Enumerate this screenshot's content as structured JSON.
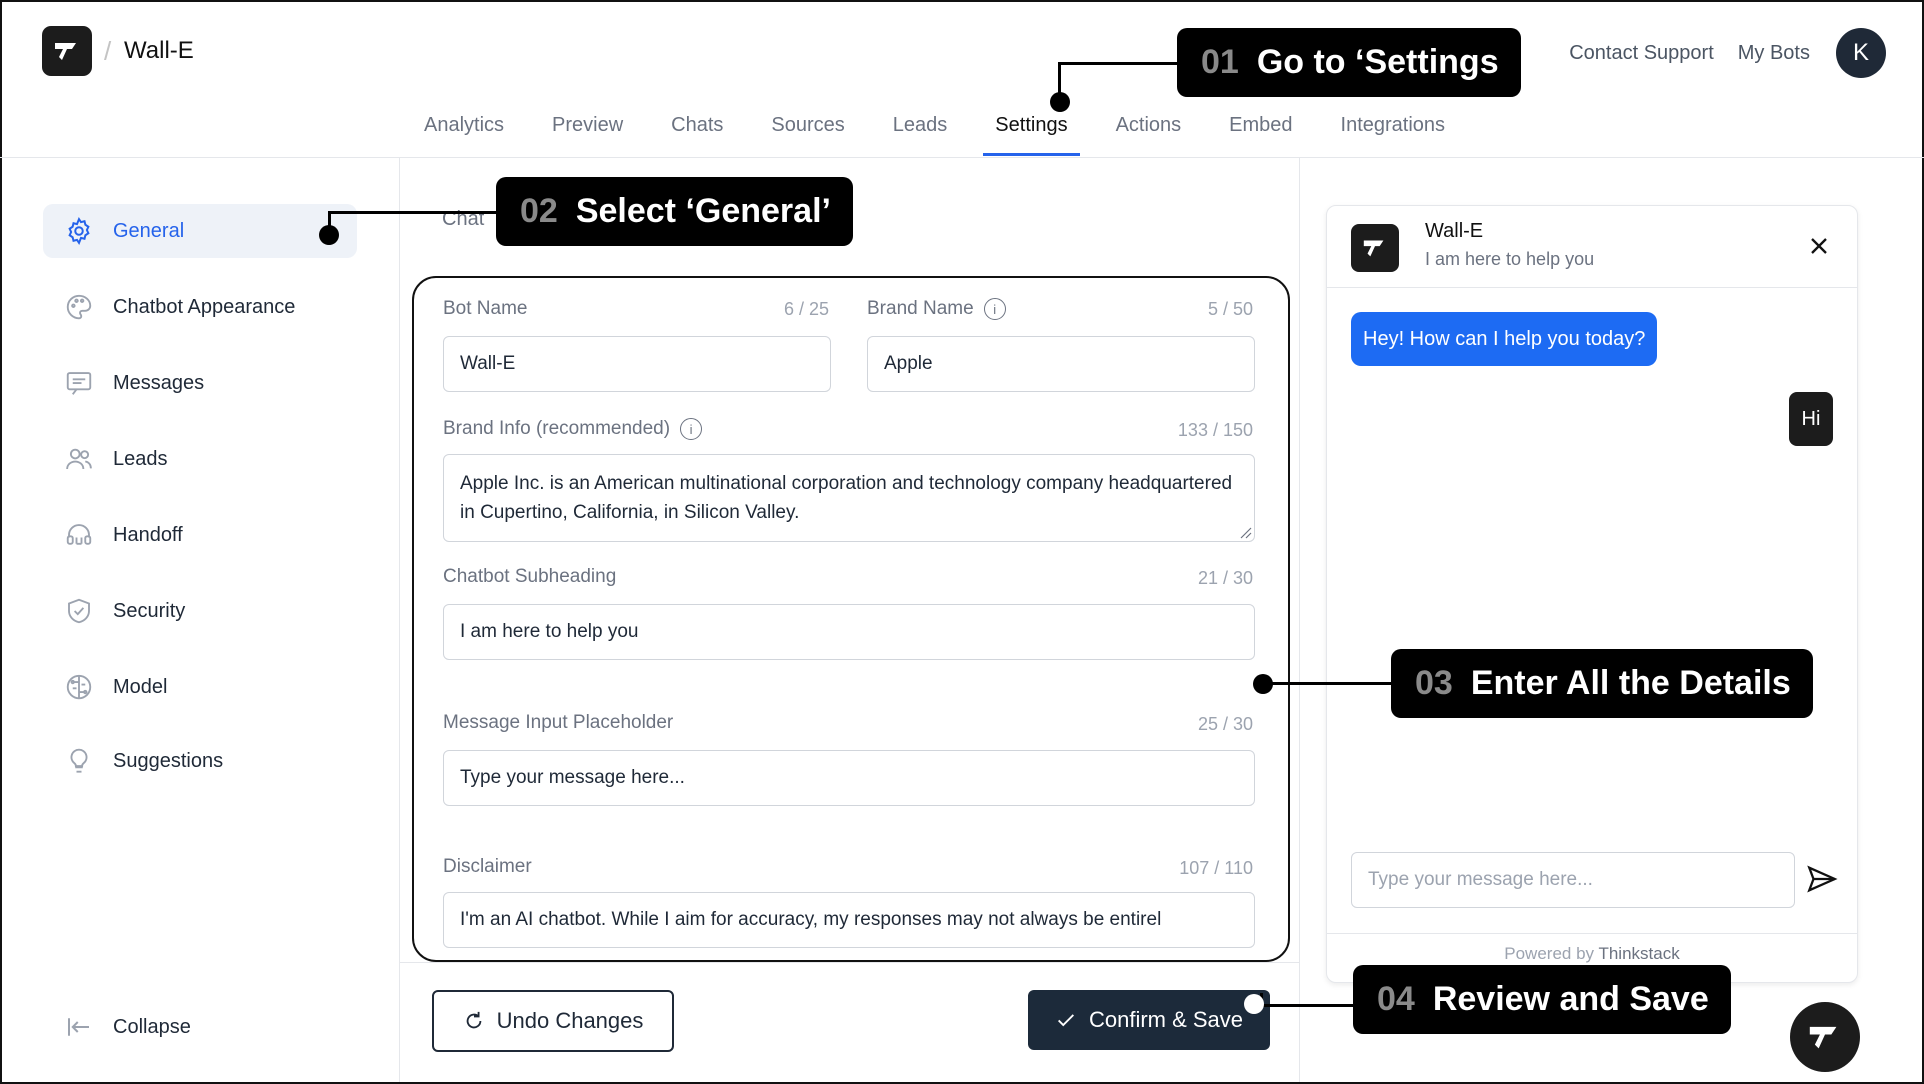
{
  "header": {
    "bot_name": "Wall-E",
    "separator": "/",
    "links": {
      "contact": "Contact Support",
      "my_bots": "My Bots"
    },
    "avatar_initial": "K"
  },
  "tabs": [
    "Analytics",
    "Preview",
    "Chats",
    "Sources",
    "Leads",
    "Settings",
    "Actions",
    "Embed",
    "Integrations"
  ],
  "active_tab": "Settings",
  "sidebar": {
    "items": [
      {
        "label": "General",
        "icon": "gear-icon"
      },
      {
        "label": "Chatbot Appearance",
        "icon": "palette-icon"
      },
      {
        "label": "Messages",
        "icon": "message-icon"
      },
      {
        "label": "Leads",
        "icon": "users-icon"
      },
      {
        "label": "Handoff",
        "icon": "headset-icon"
      },
      {
        "label": "Security",
        "icon": "shield-icon"
      },
      {
        "label": "Model",
        "icon": "brain-icon"
      },
      {
        "label": "Suggestions",
        "icon": "lightbulb-icon"
      }
    ],
    "collapse_label": "Collapse"
  },
  "form": {
    "top_text": "Chat",
    "bot_name": {
      "label": "Bot Name",
      "count": "6 / 25",
      "value": "Wall-E"
    },
    "brand_name": {
      "label": "Brand Name",
      "count": "5 / 50",
      "value": "Apple"
    },
    "brand_info": {
      "label": "Brand Info (recommended)",
      "count": "133 / 150",
      "value": "Apple Inc. is an American multinational corporation and technology company headquartered in Cupertino, California, in Silicon Valley."
    },
    "subheading": {
      "label": "Chatbot Subheading",
      "count": "21 / 30",
      "value": "I am here to help you"
    },
    "placeholder": {
      "label": "Message Input Placeholder",
      "count": "25 / 30",
      "value": "Type your message here..."
    },
    "disclaimer": {
      "label": "Disclaimer",
      "count": "107 / 110",
      "value": "I'm an AI chatbot. While I aim for accuracy, my responses may not always be entirel"
    },
    "info_glyph": "i"
  },
  "buttons": {
    "undo": "Undo Changes",
    "save": "Confirm & Save"
  },
  "chat_preview": {
    "name": "Wall-E",
    "subheading": "I am here to help you",
    "bot_message": "Hey! How can I help you today?",
    "user_message": "Hi",
    "input_placeholder": "Type your message here...",
    "powered_prefix": "Powered by",
    "powered_brand": "Thinkstack"
  },
  "callouts": [
    {
      "num": "01",
      "text": "Go to ‘Settings"
    },
    {
      "num": "02",
      "text": "Select ‘General’"
    },
    {
      "num": "03",
      "text": "Enter All the Details"
    },
    {
      "num": "04",
      "text": "Review and Save"
    }
  ],
  "colors": {
    "accent": "#2563eb",
    "bubble": "#1d6bf3",
    "dark": "#1c2a3a",
    "callout": "#000000"
  }
}
